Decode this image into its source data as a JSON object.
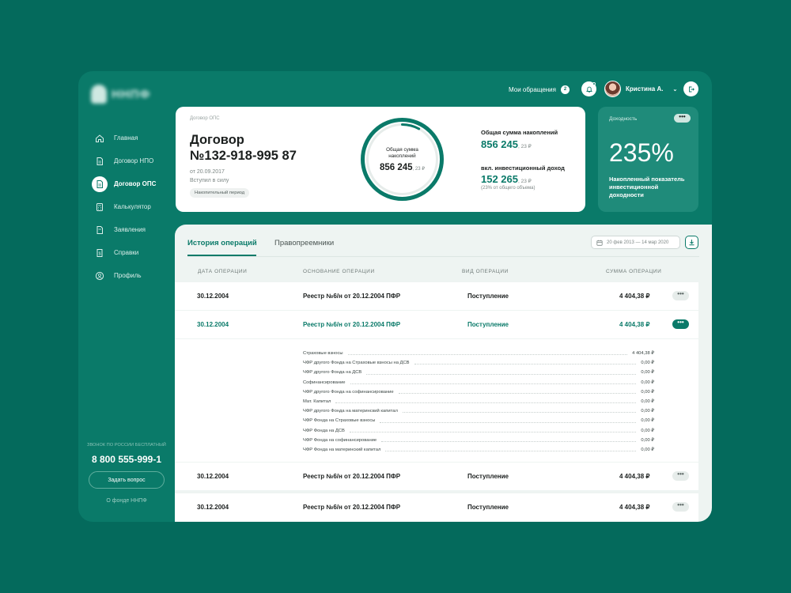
{
  "sidebar": {
    "nav": [
      {
        "label": "Главная",
        "icon": "home-icon"
      },
      {
        "label": "Договор НПО",
        "icon": "document-icon"
      },
      {
        "label": "Договор ОПС",
        "icon": "document-icon",
        "active": true
      },
      {
        "label": "Калькулятор",
        "icon": "calculator-icon"
      },
      {
        "label": "Заявления",
        "icon": "file-icon"
      },
      {
        "label": "Справки",
        "icon": "certificate-icon"
      },
      {
        "label": "Профиль",
        "icon": "user-icon"
      }
    ],
    "call_label": "ЗВОНОК ПО РОССИИ БЕСПЛАТНЫЙ",
    "phone": "8 800 555-999-1",
    "ask_button": "Задать вопрос",
    "about_link": "О фонде ННПФ"
  },
  "topbar": {
    "appeals_label": "Мои обращения",
    "appeals_count": "2",
    "user_name": "Кристина А."
  },
  "contract": {
    "label": "Договор ОПС",
    "title_line1": "Договор",
    "title_line2": "№132-918-995 87",
    "date": "от 20.09.2017",
    "status": "Вступил в силу",
    "period_tag": "Накопительный период",
    "ring_label": "Общая сумма накоплений",
    "ring_value": "856 245",
    "ring_cents": ", 23 ₽",
    "ring_fill_fraction": 0.08,
    "total_label": "Общая сумма накоплений",
    "total_value": "856 245",
    "total_cents": ", 23 ₽",
    "invest_label": "вкл. инвестиционный доход",
    "invest_value": "152 265",
    "invest_cents": ", 23 ₽",
    "invest_note": "(23% от общего объема)"
  },
  "yield": {
    "label": "Доходность",
    "more": "•••",
    "value": "235%",
    "description": "Накопленный показатель инвестиционной доходности"
  },
  "operations": {
    "tabs": [
      "История операций",
      "Правопреемники"
    ],
    "date_range": "20 фев 2013 — 14 мар 2020",
    "columns": [
      "ДАТА ОПЕРАЦИИ",
      "ОСНОВАНИЕ ОПЕРАЦИИ",
      "ВИД ОПЕРАЦИИ",
      "СУММА ОПЕРАЦИИ"
    ],
    "rows": [
      {
        "date": "30.12.2004",
        "basis": "Реестр №6/н от 20.12.2004 ПФР",
        "type": "Поступление",
        "amount": "4 404,38 ₽",
        "more": "•••"
      },
      {
        "date": "30.12.2004",
        "basis": "Реестр №6/н от 20.12.2004 ПФР",
        "type": "Поступление",
        "amount": "4 404,38 ₽",
        "more": "•••"
      },
      {
        "date": "30.12.2004",
        "basis": "Реестр №6/н от 20.12.2004 ПФР",
        "type": "Поступление",
        "amount": "4 404,38 ₽",
        "more": "•••"
      },
      {
        "date": "30.12.2004",
        "basis": "Реестр №6/н от 20.12.2004 ПФР",
        "type": "Поступление",
        "amount": "4 404,38 ₽",
        "more": "•••"
      }
    ],
    "details": [
      {
        "label": "Страховые взносы",
        "value": "4 404,38 ₽"
      },
      {
        "label": "ЧФР другого Фонда на Страховые взносы на ДСВ",
        "value": "0,00 ₽"
      },
      {
        "label": "ЧФР другого Фонда  на ДСВ",
        "value": "0,00 ₽"
      },
      {
        "label": "Софинансирование",
        "value": "0,00 ₽"
      },
      {
        "label": "ЧФР другого Фонда  на софинансирование",
        "value": "0,00 ₽"
      },
      {
        "label": "Мат. Капитал",
        "value": "0,00 ₽"
      },
      {
        "label": "ЧФР другого Фонда  на материнский капитал",
        "value": "0,00 ₽"
      },
      {
        "label": "ЧФР Фонда на Страховые взносы",
        "value": "0,00 ₽"
      },
      {
        "label": "ЧФР  Фонда  на ДСВ",
        "value": "0,00 ₽"
      },
      {
        "label": "ЧФР  Фонда   на софинансирование",
        "value": "0,00 ₽"
      },
      {
        "label": "ЧФР  Фонда  на материнский капитал",
        "value": "0,00 ₽"
      }
    ]
  },
  "colors": {
    "brand": "#0a7a69",
    "background": "#046a5c",
    "accent_light": "#1f8b7a"
  }
}
